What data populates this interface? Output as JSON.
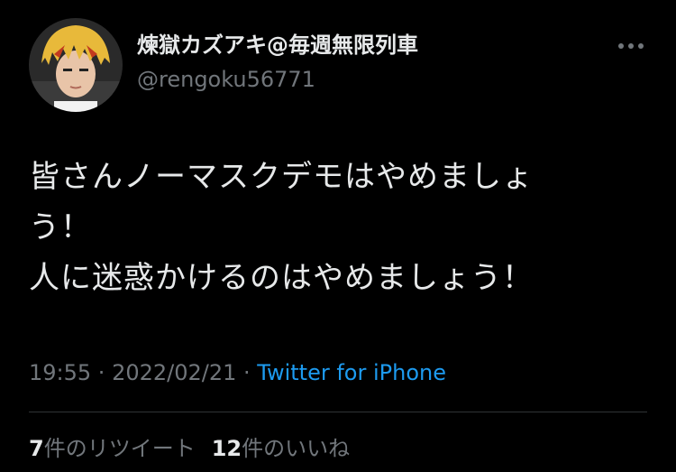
{
  "colors": {
    "background": "#000000",
    "text": "#e7e9ea",
    "muted": "#71767b",
    "link": "#1d9bf0",
    "divider": "#2f3336"
  },
  "author": {
    "display_name": "煉獄カズアキ@毎週無限列車",
    "handle": "@rengoku56771",
    "avatar_icon": "user-avatar"
  },
  "menu": {
    "icon": "more-horizontal-icon"
  },
  "tweet": {
    "lines": [
      "皆さんノーマスクデモはやめましょ",
      "う！",
      "人に迷惑かけるのはやめましょう！"
    ]
  },
  "meta": {
    "time": "19:55",
    "separator": " · ",
    "date": "2022/02/21",
    "source": "Twitter for iPhone"
  },
  "stats": {
    "retweets_count": "7",
    "retweets_label": "件のリツイート",
    "likes_count": "12",
    "likes_label": "件のいいね"
  }
}
